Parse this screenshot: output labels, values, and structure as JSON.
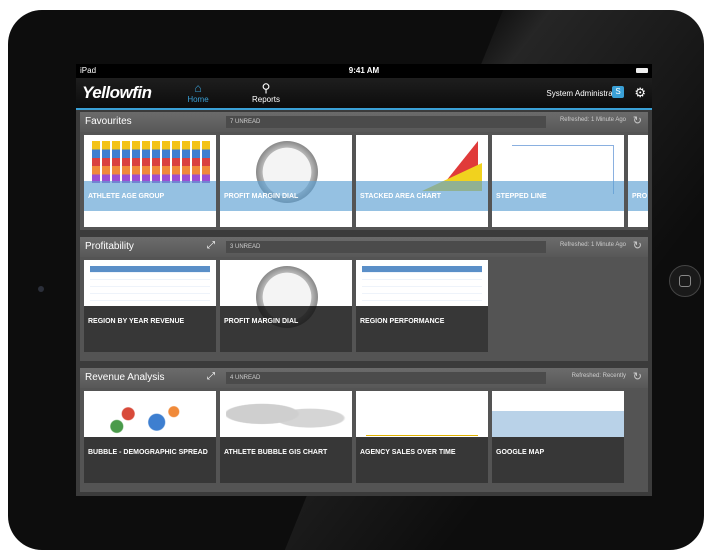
{
  "device": {
    "carrier": "iPad",
    "time": "9:41 AM"
  },
  "navbar": {
    "logo": "Yellowfin",
    "home_label": "Home",
    "reports_label": "Reports",
    "user": "System Administrator",
    "user_badge": "S"
  },
  "sections": [
    {
      "title": "Favourites",
      "unread": "7 UNREAD",
      "refreshed": "Refreshed: 1 Minute Ago",
      "tiles": [
        "ATHLETE AGE GROUP",
        "PROFIT MARGIN DIAL",
        "STACKED AREA CHART",
        "STEPPED LINE",
        "PRO"
      ]
    },
    {
      "title": "Profitability",
      "unread": "3 UNREAD",
      "refreshed": "Refreshed: 1 Minute Ago",
      "tiles": [
        "REGION BY YEAR REVENUE",
        "PROFIT MARGIN DIAL",
        "REGION PERFORMANCE"
      ]
    },
    {
      "title": "Revenue Analysis",
      "unread": "4 UNREAD",
      "refreshed": "Refreshed: Recently",
      "tiles": [
        "BUBBLE - DEMOGRAPHIC SPREAD",
        "ATHLETE BUBBLE GIS CHART",
        "AGENCY SALES OVER TIME",
        "GOOGLE MAP"
      ]
    }
  ],
  "colors": {
    "accent": "#3aa0d6"
  }
}
